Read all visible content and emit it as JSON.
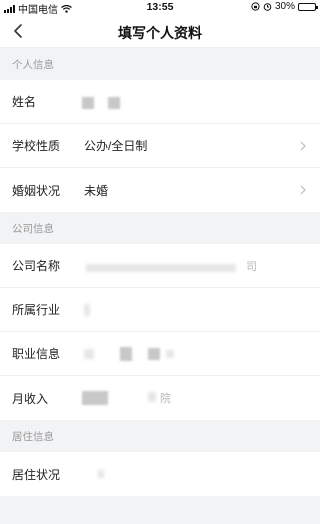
{
  "status_bar": {
    "carrier": "中国电信",
    "time": "13:55",
    "battery": "30%",
    "battery_level": 0.3
  },
  "nav": {
    "title": "填写个人资料",
    "back_icon": "chevron-left-icon"
  },
  "sections": {
    "personal": {
      "header": "个人信息",
      "name_label": "姓名",
      "school_type_label": "学校性质",
      "school_type_value": "公办/全日制",
      "marital_label": "婚姻状况",
      "marital_value": "未婚"
    },
    "company": {
      "header": "公司信息",
      "company_name_label": "公司名称",
      "company_name_partial": "司",
      "industry_label": "所属行业",
      "job_label": "职业信息",
      "income_label": "月收入",
      "income_partial": "院"
    },
    "residence": {
      "header": "居住信息",
      "status_label": "居住状况"
    }
  }
}
